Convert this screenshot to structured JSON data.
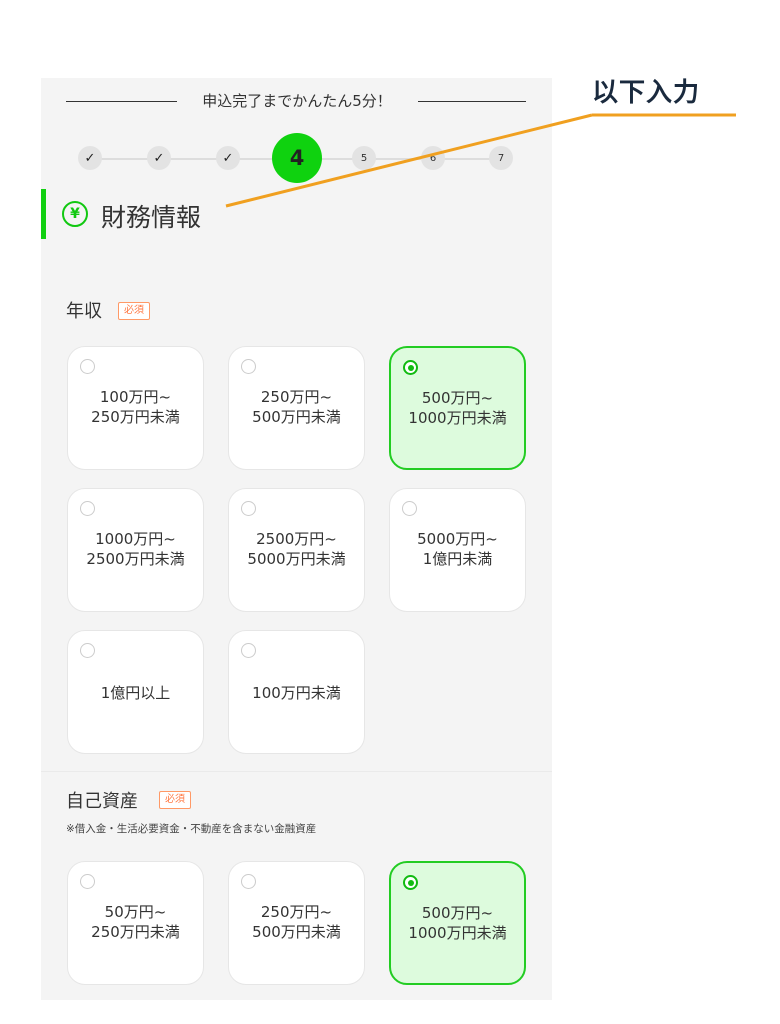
{
  "header": {
    "text": "申込完了までかんたん5分！"
  },
  "steps": [
    {
      "label": "✓",
      "state": "done"
    },
    {
      "label": "✓",
      "state": "done"
    },
    {
      "label": "✓",
      "state": "done"
    },
    {
      "label": "4",
      "state": "current"
    },
    {
      "label": "5",
      "state": "pending"
    },
    {
      "label": "6",
      "state": "pending"
    },
    {
      "label": "7",
      "state": "pending"
    }
  ],
  "section": {
    "icon": "yen-circle-icon",
    "icon_glyph": "¥",
    "title": "財務情報"
  },
  "annual_income": {
    "label": "年収",
    "required_badge": "必須",
    "options": [
      {
        "line1": "100万円~",
        "line2": "250万円未満",
        "selected": false
      },
      {
        "line1": "250万円~",
        "line2": "500万円未満",
        "selected": false
      },
      {
        "line1": "500万円~",
        "line2": "1000万円未満",
        "selected": true
      },
      {
        "line1": "1000万円~",
        "line2": "2500万円未満",
        "selected": false
      },
      {
        "line1": "2500万円~",
        "line2": "5000万円未満",
        "selected": false
      },
      {
        "line1": "5000万円~",
        "line2": "1億円未満",
        "selected": false
      },
      {
        "line1": "1億円以上",
        "line2": "",
        "selected": false
      },
      {
        "line1": "100万円未満",
        "line2": "",
        "selected": false
      }
    ]
  },
  "own_assets": {
    "label": "自己資産",
    "required_badge": "必須",
    "note": "※借入金・生活必要資金・不動産を含まない金融資産",
    "options": [
      {
        "line1": "50万円~",
        "line2": "250万円未満",
        "selected": false
      },
      {
        "line1": "250万円~",
        "line2": "500万円未満",
        "selected": false
      },
      {
        "line1": "500万円~",
        "line2": "1000万円未満",
        "selected": true
      }
    ]
  },
  "annotation": {
    "text": "以下入力",
    "color": "#f0a020"
  },
  "colors": {
    "accent_green": "#0fd20f",
    "badge_orange": "#ff7a45",
    "selected_bg": "#ddfbdd"
  }
}
